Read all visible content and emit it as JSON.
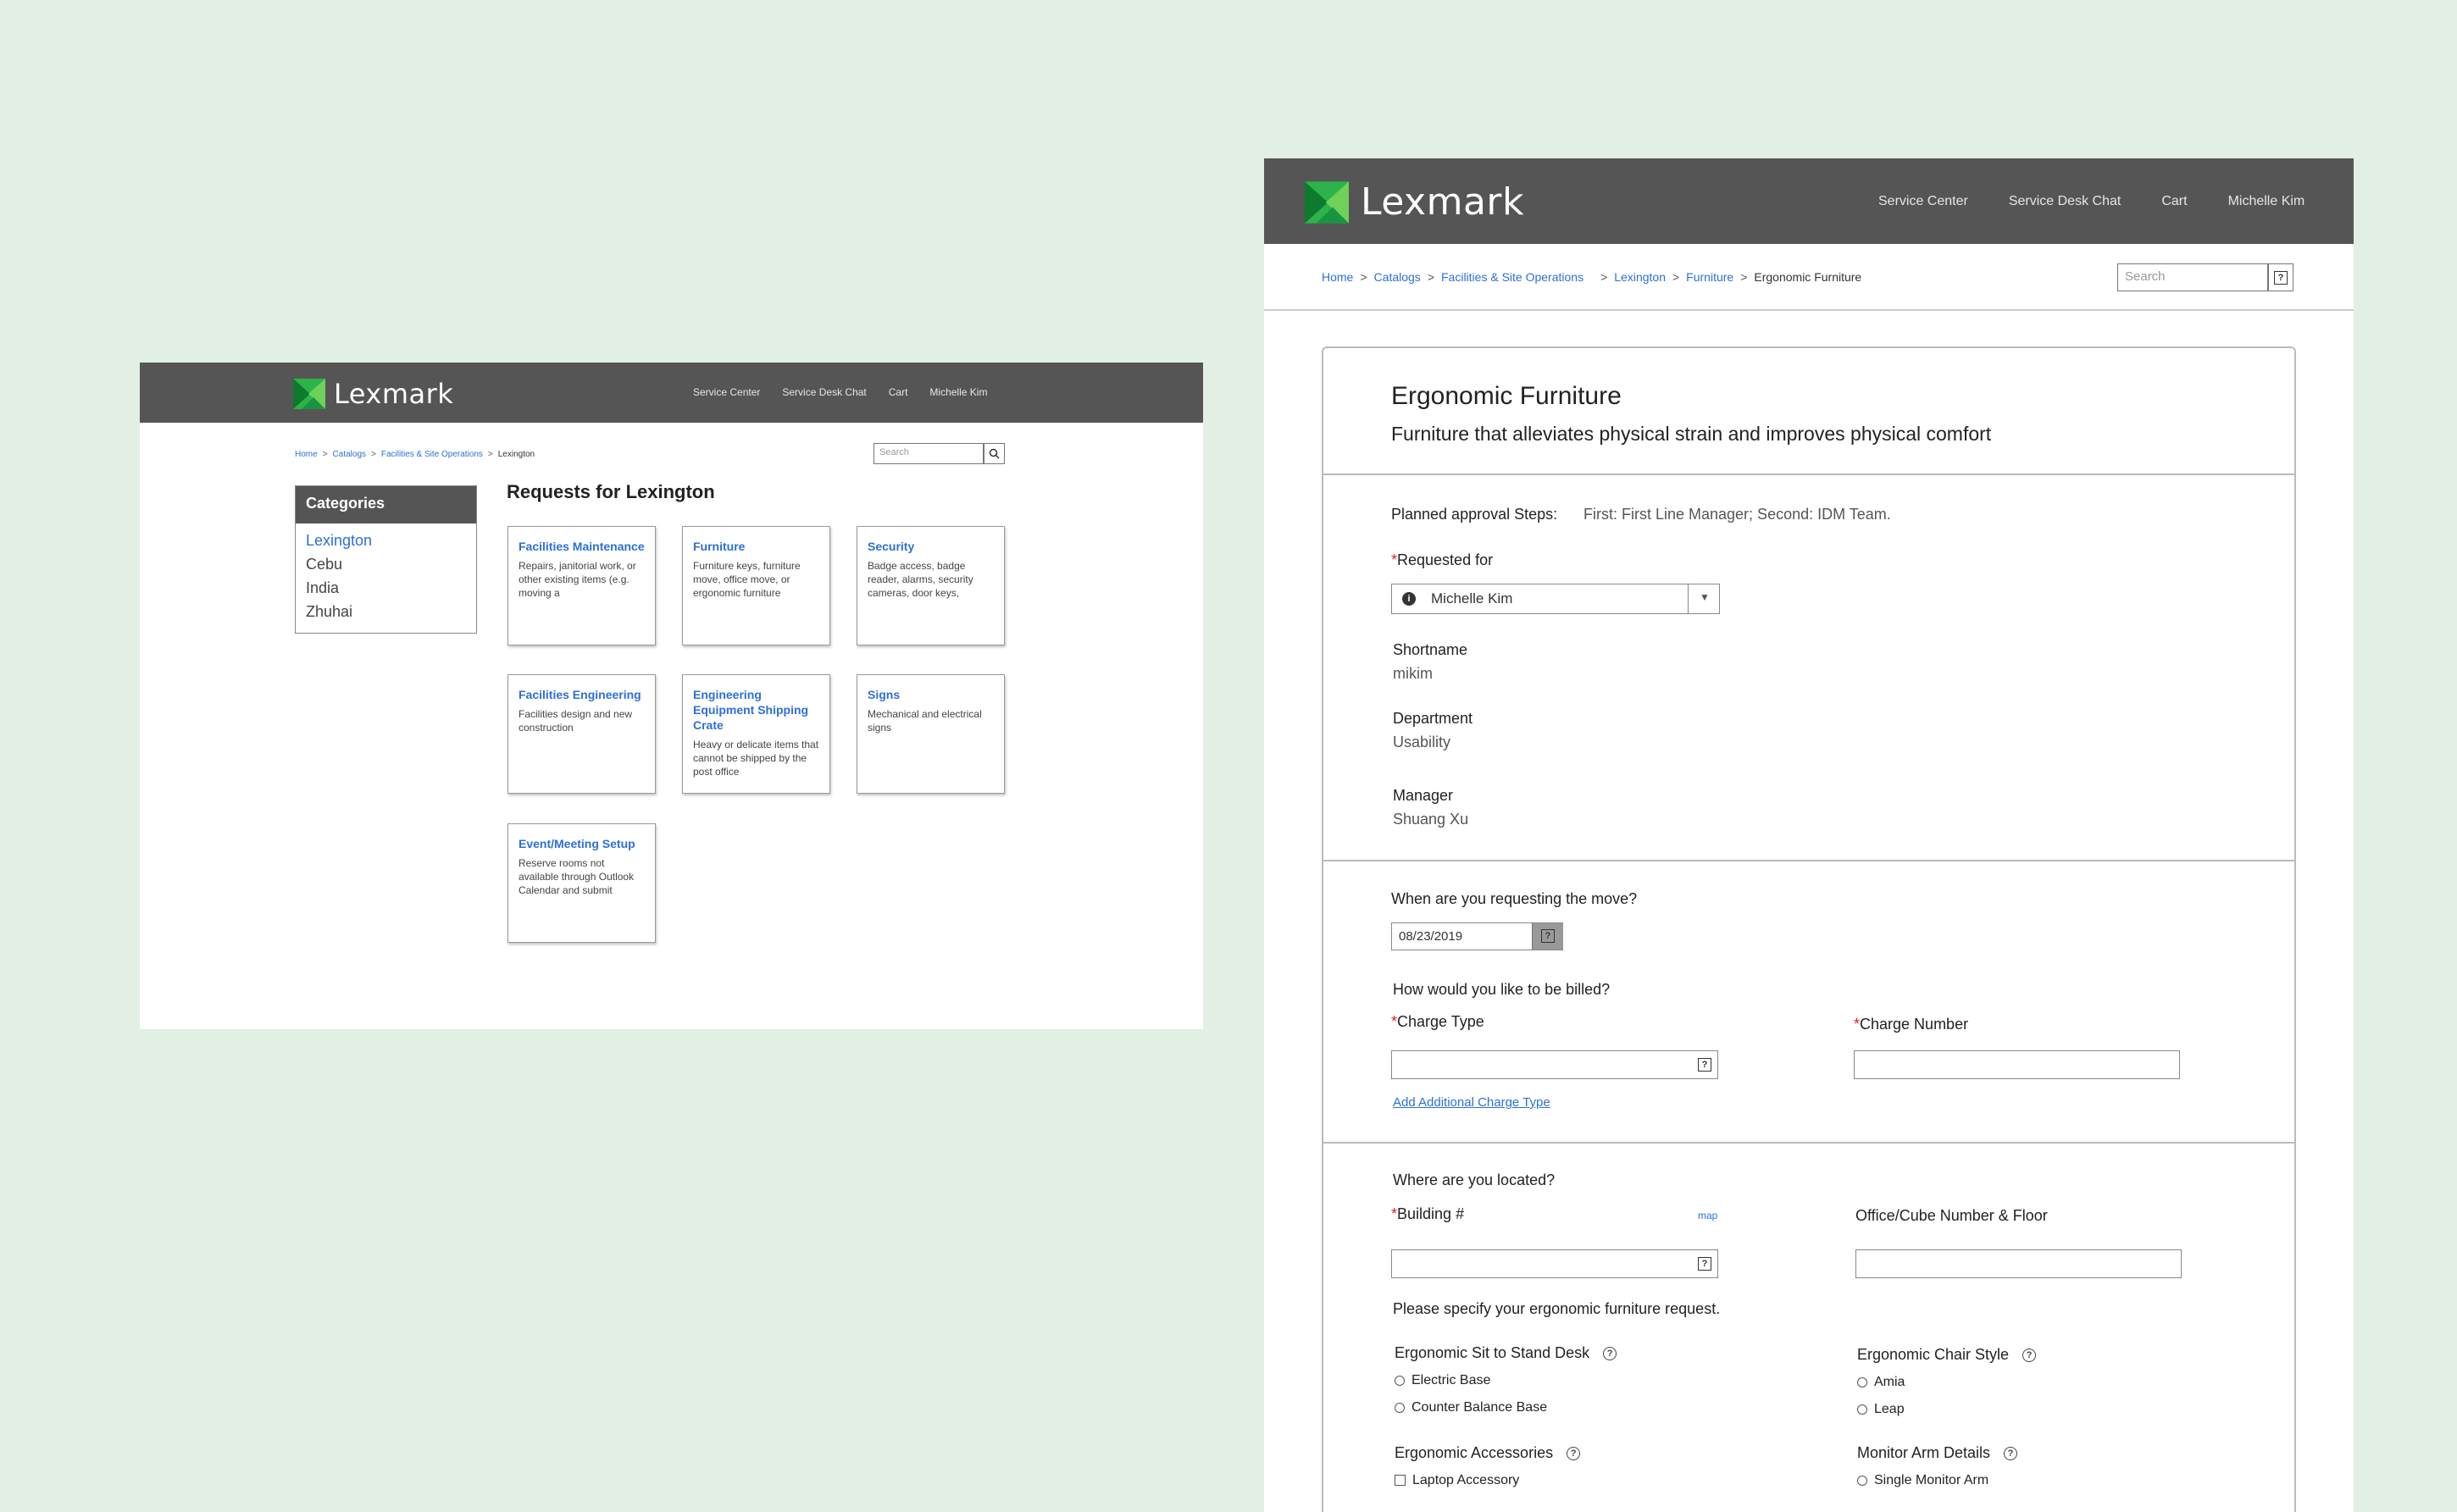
{
  "brand": {
    "logo_text": "Lexmark",
    "accent_color": "#2cb34a",
    "header_color": "#555555",
    "link_color": "#2d6fd6"
  },
  "left": {
    "nav": [
      "Service Center",
      "Service Desk Chat",
      "Cart",
      "Michelle Kim"
    ],
    "breadcrumb": [
      "Home",
      "Catalogs",
      "Facilities & Site Operations",
      "Lexington"
    ],
    "search_placeholder": "Search",
    "categories_title": "Categories",
    "categories": [
      "Lexington",
      "Cebu",
      "India",
      "Zhuhai"
    ],
    "requests_title": "Requests for Lexington",
    "tiles": [
      {
        "title": "Facilities Maintenance",
        "desc": "Repairs, janitorial work, or other existing items (e.g. moving a"
      },
      {
        "title": "Furniture",
        "desc": "Furniture keys, furniture move, office move, or ergonomic furniture"
      },
      {
        "title": "Security",
        "desc": "Badge access, badge reader, alarms, security cameras, door keys,"
      },
      {
        "title": "Facilities Engineering",
        "desc": "Facilities design and new construction"
      },
      {
        "title": "Engineering Equipment Shipping Crate",
        "desc": "Heavy or delicate items that cannot be shipped by the post office"
      },
      {
        "title": "Signs",
        "desc": "Mechanical and electrical signs"
      },
      {
        "title": "Event/Meeting Setup",
        "desc": "Reserve rooms not available through Outlook Calendar and submit"
      }
    ]
  },
  "right": {
    "nav": [
      "Service Center",
      "Service Desk Chat",
      "Cart",
      "Michelle Kim"
    ],
    "breadcrumb": [
      "Home",
      "Catalogs",
      "Facilities & Site Operations",
      "Lexington",
      "Furniture",
      "Ergonomic Furniture"
    ],
    "search_placeholder": "Search",
    "title": "Ergonomic Furniture",
    "subtitle": "Furniture that alleviates physical strain and improves physical comfort",
    "approval_label": "Planned approval Steps:",
    "approval_value": "First: First Line Manager; Second: IDM Team.",
    "requested_for_label": "Requested for",
    "requested_for_value": "Michelle Kim",
    "shortname_label": "Shortname",
    "shortname_value": "mikim",
    "department_label": "Department",
    "department_value": "Usability",
    "manager_label": "Manager",
    "manager_value": "Shuang Xu",
    "move_question": "When are you requesting the move?",
    "move_date": "08/23/2019",
    "billing_question": "How would you like to be billed?",
    "charge_type_label": "Charge Type",
    "charge_number_label": "Charge Number",
    "add_charge_link": "Add Additional Charge Type",
    "location_question": "Where are you located?",
    "building_label": "Building #",
    "map_link": "map",
    "office_label": "Office/Cube Number & Floor",
    "specify_text": "Please specify your ergonomic furniture request.",
    "desk_label": "Ergonomic Sit to Stand Desk",
    "desk_options": [
      "Electric Base",
      "Counter Balance Base"
    ],
    "chair_label": "Ergonomic Chair Style",
    "chair_options": [
      "Amia",
      "Leap"
    ],
    "accessories_label": "Ergonomic Accessories",
    "accessories_options": [
      "Laptop Accessory"
    ],
    "monitor_label": "Monitor Arm Details",
    "monitor_options": [
      "Single Monitor Arm"
    ]
  }
}
